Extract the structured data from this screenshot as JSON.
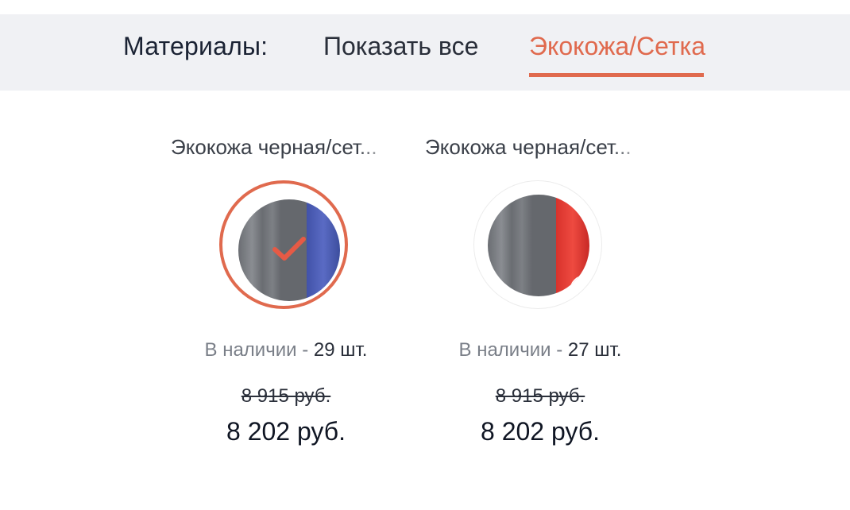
{
  "filter": {
    "label": "Материалы:",
    "tabs": [
      {
        "label": "Показать все",
        "active": false
      },
      {
        "label": "Экокожа/Сетка",
        "active": true
      }
    ],
    "accent_color": "#e06a4e"
  },
  "products": [
    {
      "title": "Экокожа черная/сет...",
      "selected": true,
      "accent_stripe_color": "#4f61b8",
      "zoom_icon": "search-icon",
      "stock_label": "В наличии - ",
      "stock_qty": "29 шт.",
      "old_price": "8 915 руб.",
      "price": "8 202 руб."
    },
    {
      "title": "Экокожа черная/сет...",
      "selected": false,
      "accent_stripe_color": "#e0443c",
      "zoom_icon": "search-icon",
      "stock_label": "В наличии - ",
      "stock_qty": "27 шт.",
      "old_price": "8 915 руб.",
      "price": "8 202 руб."
    }
  ]
}
